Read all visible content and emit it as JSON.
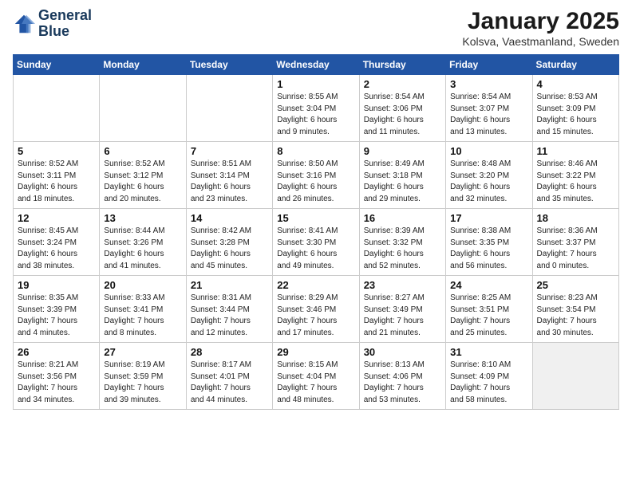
{
  "logo": {
    "line1": "General",
    "line2": "Blue"
  },
  "title": "January 2025",
  "location": "Kolsva, Vaestmanland, Sweden",
  "weekdays": [
    "Sunday",
    "Monday",
    "Tuesday",
    "Wednesday",
    "Thursday",
    "Friday",
    "Saturday"
  ],
  "weeks": [
    [
      {
        "day": "",
        "info": ""
      },
      {
        "day": "",
        "info": ""
      },
      {
        "day": "",
        "info": ""
      },
      {
        "day": "1",
        "info": "Sunrise: 8:55 AM\nSunset: 3:04 PM\nDaylight: 6 hours\nand 9 minutes."
      },
      {
        "day": "2",
        "info": "Sunrise: 8:54 AM\nSunset: 3:06 PM\nDaylight: 6 hours\nand 11 minutes."
      },
      {
        "day": "3",
        "info": "Sunrise: 8:54 AM\nSunset: 3:07 PM\nDaylight: 6 hours\nand 13 minutes."
      },
      {
        "day": "4",
        "info": "Sunrise: 8:53 AM\nSunset: 3:09 PM\nDaylight: 6 hours\nand 15 minutes."
      }
    ],
    [
      {
        "day": "5",
        "info": "Sunrise: 8:52 AM\nSunset: 3:11 PM\nDaylight: 6 hours\nand 18 minutes."
      },
      {
        "day": "6",
        "info": "Sunrise: 8:52 AM\nSunset: 3:12 PM\nDaylight: 6 hours\nand 20 minutes."
      },
      {
        "day": "7",
        "info": "Sunrise: 8:51 AM\nSunset: 3:14 PM\nDaylight: 6 hours\nand 23 minutes."
      },
      {
        "day": "8",
        "info": "Sunrise: 8:50 AM\nSunset: 3:16 PM\nDaylight: 6 hours\nand 26 minutes."
      },
      {
        "day": "9",
        "info": "Sunrise: 8:49 AM\nSunset: 3:18 PM\nDaylight: 6 hours\nand 29 minutes."
      },
      {
        "day": "10",
        "info": "Sunrise: 8:48 AM\nSunset: 3:20 PM\nDaylight: 6 hours\nand 32 minutes."
      },
      {
        "day": "11",
        "info": "Sunrise: 8:46 AM\nSunset: 3:22 PM\nDaylight: 6 hours\nand 35 minutes."
      }
    ],
    [
      {
        "day": "12",
        "info": "Sunrise: 8:45 AM\nSunset: 3:24 PM\nDaylight: 6 hours\nand 38 minutes."
      },
      {
        "day": "13",
        "info": "Sunrise: 8:44 AM\nSunset: 3:26 PM\nDaylight: 6 hours\nand 41 minutes."
      },
      {
        "day": "14",
        "info": "Sunrise: 8:42 AM\nSunset: 3:28 PM\nDaylight: 6 hours\nand 45 minutes."
      },
      {
        "day": "15",
        "info": "Sunrise: 8:41 AM\nSunset: 3:30 PM\nDaylight: 6 hours\nand 49 minutes."
      },
      {
        "day": "16",
        "info": "Sunrise: 8:39 AM\nSunset: 3:32 PM\nDaylight: 6 hours\nand 52 minutes."
      },
      {
        "day": "17",
        "info": "Sunrise: 8:38 AM\nSunset: 3:35 PM\nDaylight: 6 hours\nand 56 minutes."
      },
      {
        "day": "18",
        "info": "Sunrise: 8:36 AM\nSunset: 3:37 PM\nDaylight: 7 hours\nand 0 minutes."
      }
    ],
    [
      {
        "day": "19",
        "info": "Sunrise: 8:35 AM\nSunset: 3:39 PM\nDaylight: 7 hours\nand 4 minutes."
      },
      {
        "day": "20",
        "info": "Sunrise: 8:33 AM\nSunset: 3:41 PM\nDaylight: 7 hours\nand 8 minutes."
      },
      {
        "day": "21",
        "info": "Sunrise: 8:31 AM\nSunset: 3:44 PM\nDaylight: 7 hours\nand 12 minutes."
      },
      {
        "day": "22",
        "info": "Sunrise: 8:29 AM\nSunset: 3:46 PM\nDaylight: 7 hours\nand 17 minutes."
      },
      {
        "day": "23",
        "info": "Sunrise: 8:27 AM\nSunset: 3:49 PM\nDaylight: 7 hours\nand 21 minutes."
      },
      {
        "day": "24",
        "info": "Sunrise: 8:25 AM\nSunset: 3:51 PM\nDaylight: 7 hours\nand 25 minutes."
      },
      {
        "day": "25",
        "info": "Sunrise: 8:23 AM\nSunset: 3:54 PM\nDaylight: 7 hours\nand 30 minutes."
      }
    ],
    [
      {
        "day": "26",
        "info": "Sunrise: 8:21 AM\nSunset: 3:56 PM\nDaylight: 7 hours\nand 34 minutes."
      },
      {
        "day": "27",
        "info": "Sunrise: 8:19 AM\nSunset: 3:59 PM\nDaylight: 7 hours\nand 39 minutes."
      },
      {
        "day": "28",
        "info": "Sunrise: 8:17 AM\nSunset: 4:01 PM\nDaylight: 7 hours\nand 44 minutes."
      },
      {
        "day": "29",
        "info": "Sunrise: 8:15 AM\nSunset: 4:04 PM\nDaylight: 7 hours\nand 48 minutes."
      },
      {
        "day": "30",
        "info": "Sunrise: 8:13 AM\nSunset: 4:06 PM\nDaylight: 7 hours\nand 53 minutes."
      },
      {
        "day": "31",
        "info": "Sunrise: 8:10 AM\nSunset: 4:09 PM\nDaylight: 7 hours\nand 58 minutes."
      },
      {
        "day": "",
        "info": ""
      }
    ]
  ]
}
